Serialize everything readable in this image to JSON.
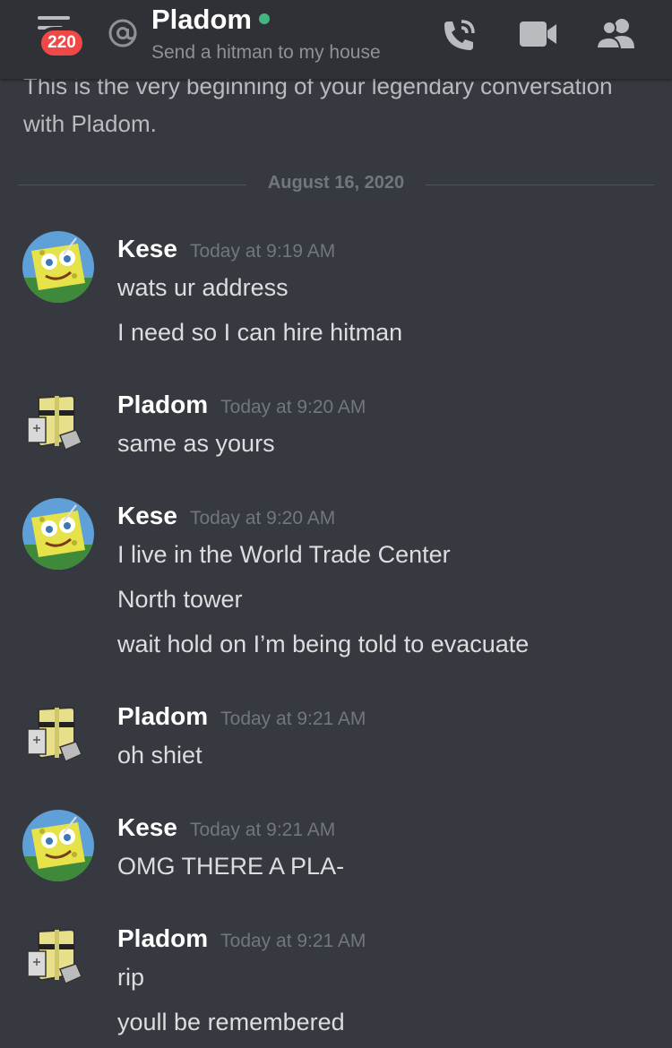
{
  "header": {
    "unread_badge": "220",
    "channel_name": "Pladom",
    "status_text": "Send a hitman to my house"
  },
  "intro": {
    "text": "This is the very beginning of your legendary conversation with Pladom."
  },
  "date_divider": "August 16, 2020",
  "colors": {
    "background": "#36393f",
    "header": "#2f3136",
    "badge": "#f04747",
    "online": "#43b581"
  },
  "icons": [
    "menu-icon",
    "at-icon",
    "call-icon",
    "video-icon",
    "members-icon"
  ],
  "messages": [
    {
      "author": "Kese",
      "time": "Today at 9:19 AM",
      "lines": [
        "wats ur address",
        "I need so I can hire hitman"
      ]
    },
    {
      "author": "Pladom",
      "time": "Today at 9:20 AM",
      "lines": [
        "same as yours"
      ]
    },
    {
      "author": "Kese",
      "time": "Today at 9:20 AM",
      "lines": [
        "I live in the World Trade Center",
        "North tower",
        "wait hold on I’m being told to evacuate"
      ]
    },
    {
      "author": "Pladom",
      "time": "Today at 9:21 AM",
      "lines": [
        "oh shiet"
      ]
    },
    {
      "author": "Kese",
      "time": "Today at 9:21 AM",
      "lines": [
        "OMG THERE A PLA-"
      ]
    },
    {
      "author": "Pladom",
      "time": "Today at 9:21 AM",
      "lines": [
        "rip",
        "youll be remembered"
      ]
    }
  ]
}
